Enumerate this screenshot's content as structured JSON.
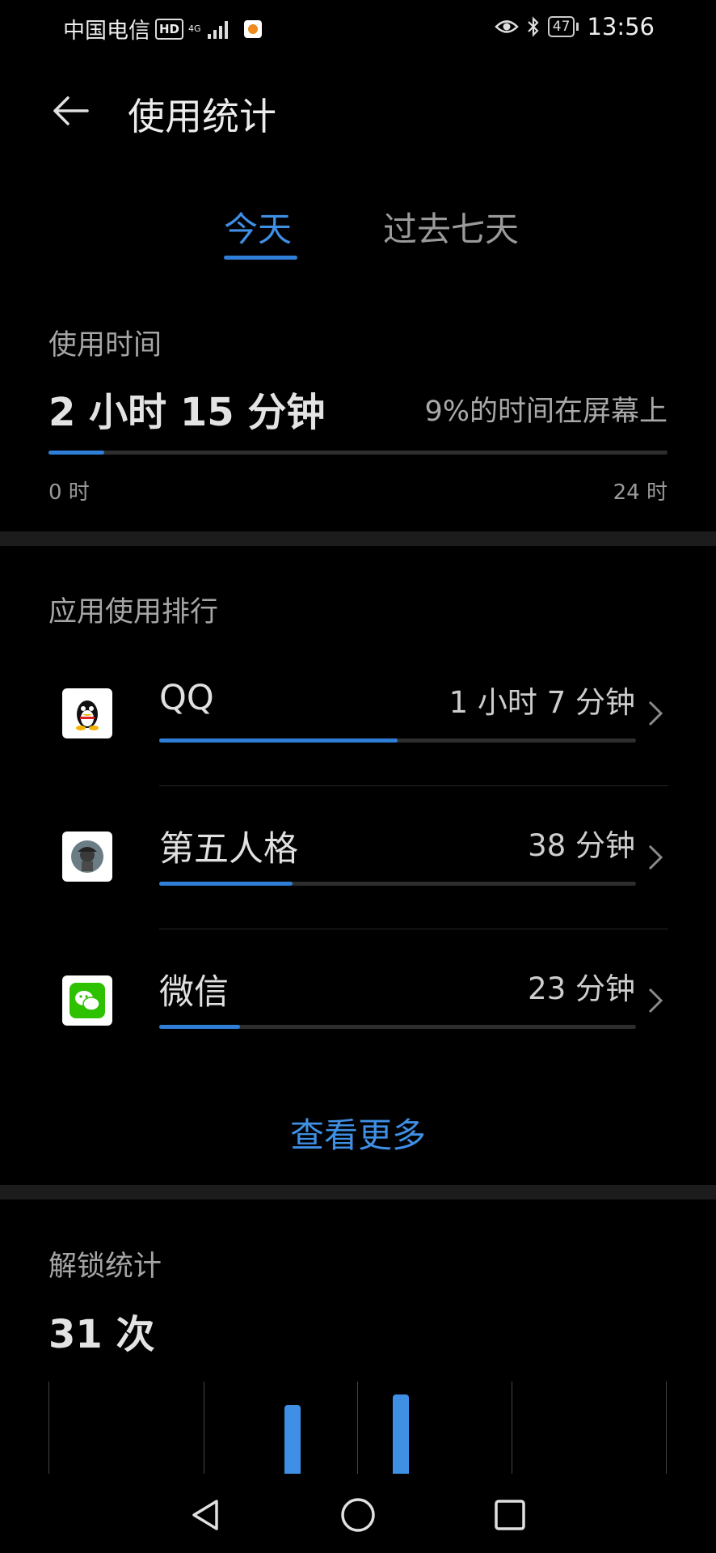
{
  "status_bar": {
    "carrier": "中国电信",
    "hd": "HD",
    "network": "4G",
    "battery": "47",
    "time": "13:56"
  },
  "header": {
    "title": "使用统计"
  },
  "tabs": [
    {
      "label": "今天",
      "active": true
    },
    {
      "label": "过去七天",
      "active": false
    }
  ],
  "usage": {
    "label": "使用时间",
    "total": "2 小时 15 分钟",
    "screen_share": "9%的时间在屏幕上",
    "progress_fraction": 0.09,
    "axis_start": "0 时",
    "axis_end": "24 时"
  },
  "ranking": {
    "label": "应用使用排行",
    "apps": [
      {
        "name": "QQ",
        "time": "1 小时 7 分钟",
        "progress_fraction": 0.5,
        "icon": "qq-penguin-icon"
      },
      {
        "name": "第五人格",
        "time": "38 分钟",
        "progress_fraction": 0.28,
        "icon": "identity-v-icon"
      },
      {
        "name": "微信",
        "time": "23 分钟",
        "progress_fraction": 0.17,
        "icon": "wechat-icon"
      }
    ],
    "more": "查看更多"
  },
  "unlock": {
    "label": "解锁统计",
    "count": "31 次"
  },
  "colors": {
    "accent": "#3f8fe4",
    "background": "#000000"
  }
}
